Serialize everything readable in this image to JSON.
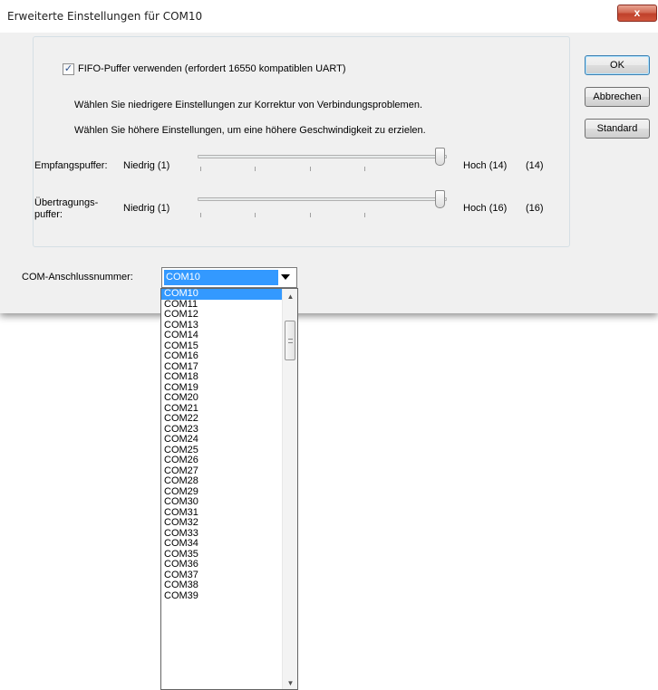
{
  "window": {
    "title": "Erweiterte Einstellungen für COM10",
    "close_glyph": "x"
  },
  "fifo": {
    "checked": true,
    "label": "FIFO-Puffer verwenden (erfordert 16550 kompatiblen UART)",
    "hint_low": "Wählen Sie niedrigere Einstellungen zur Korrektur von Verbindungsproblemen.",
    "hint_high": "Wählen Sie höhere Einstellungen, um eine höhere Geschwindigkeit zu erzielen."
  },
  "receive_buffer": {
    "label": "Empfangspuffer:",
    "low_label": "Niedrig (1)",
    "high_label": "Hoch (14)",
    "value_display": "(14)",
    "min": 1,
    "max": 14,
    "value": 14
  },
  "transmit_buffer": {
    "label_line1": "Übertragungs-",
    "label_line2": "puffer:",
    "low_label": "Niedrig (1)",
    "high_label": "Hoch (16)",
    "value_display": "(16)",
    "min": 1,
    "max": 16,
    "value": 16
  },
  "buttons": {
    "ok": "OK",
    "cancel": "Abbrechen",
    "default": "Standard"
  },
  "com_port": {
    "label": "COM-Anschlussnummer:",
    "selected": "COM10",
    "options": [
      "COM10",
      "COM11",
      "COM12",
      "COM13",
      "COM14",
      "COM15",
      "COM16",
      "COM17",
      "COM18",
      "COM19",
      "COM20",
      "COM21",
      "COM22",
      "COM23",
      "COM24",
      "COM25",
      "COM26",
      "COM27",
      "COM28",
      "COM29",
      "COM30",
      "COM31",
      "COM32",
      "COM33",
      "COM34",
      "COM35",
      "COM36",
      "COM37",
      "COM38",
      "COM39"
    ]
  },
  "icons": {
    "checkbox_check": "✓",
    "scroll_up": "▲",
    "scroll_down": "▼"
  }
}
